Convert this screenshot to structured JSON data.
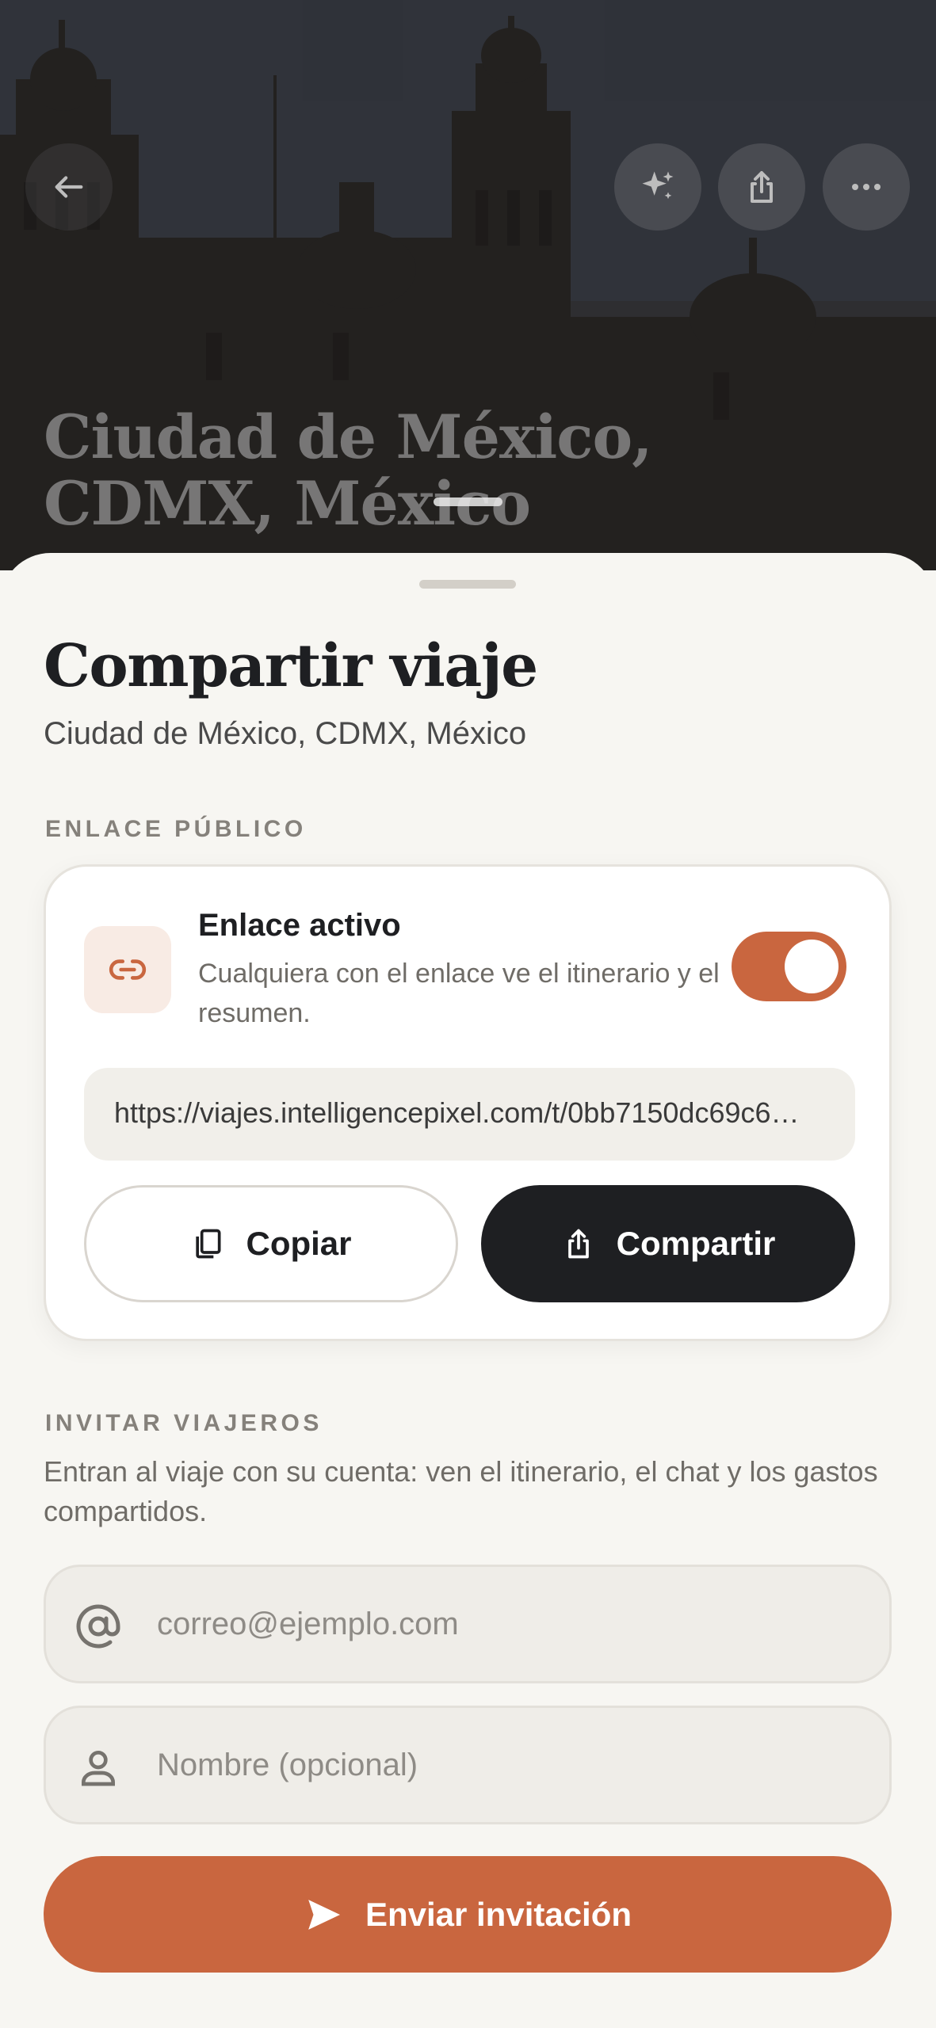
{
  "header": {
    "destination_title": "Ciudad de México, CDMX, México",
    "icons": {
      "back": "arrow-left-icon",
      "ai": "sparkle-icon",
      "share": "share-icon",
      "more": "more-horizontal-icon"
    }
  },
  "sheet": {
    "title": "Compartir viaje",
    "subtitle": "Ciudad de México, CDMX, México"
  },
  "public_link": {
    "section_label": "ENLACE PÚBLICO",
    "title": "Enlace activo",
    "description": "Cualquiera con el enlace ve el itinerario y el resumen.",
    "enabled": true,
    "url": "https://viajes.intelligencepixel.com/t/0bb7150dc69c6…",
    "copy_label": "Copiar",
    "share_label": "Compartir"
  },
  "invite": {
    "section_label": "INVITAR VIAJEROS",
    "description": "Entran al viaje con su cuenta: ven el itinerario, el chat y los gastos compartidos.",
    "email_placeholder": "correo@ejemplo.com",
    "name_placeholder": "Nombre (opcional)",
    "send_label": "Enviar invitación"
  },
  "colors": {
    "accent": "#c9663f",
    "dark": "#1e1f22",
    "background": "#f7f6f2"
  }
}
